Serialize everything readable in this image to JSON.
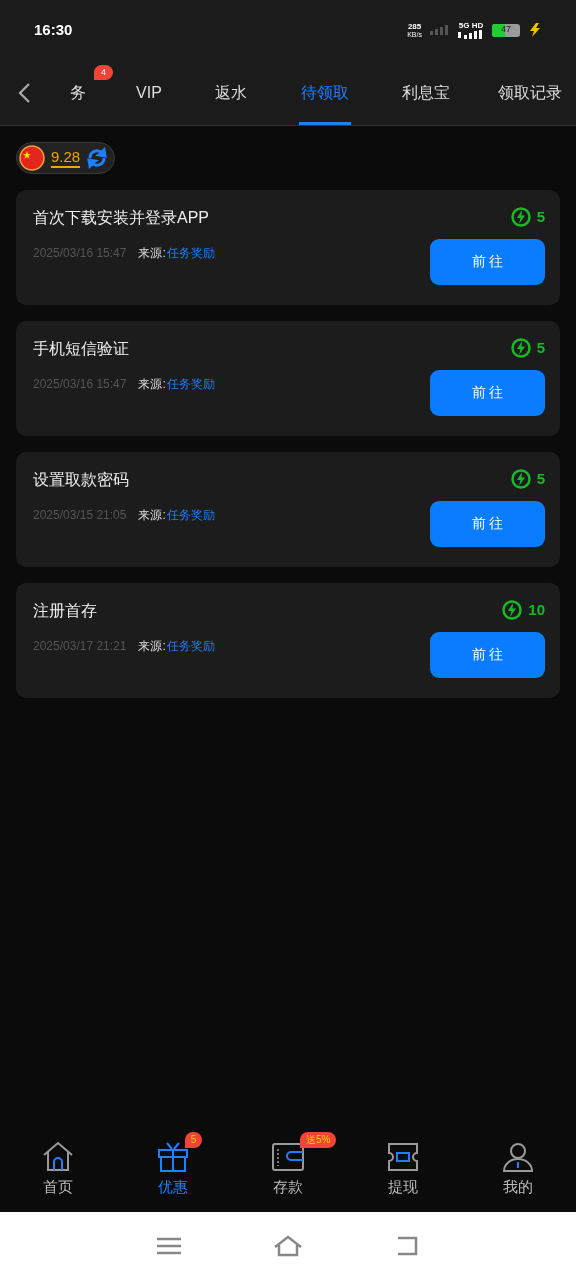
{
  "status_bar": {
    "time": "16:30",
    "speed": "285",
    "speed_unit": "KB/s",
    "network": "5G HD",
    "battery": "47"
  },
  "tabs": [
    {
      "label": "务",
      "selected": false,
      "badge": "4"
    },
    {
      "label": "VIP",
      "selected": false
    },
    {
      "label": "返水",
      "selected": false
    },
    {
      "label": "待领取",
      "selected": true
    },
    {
      "label": "利息宝",
      "selected": false
    },
    {
      "label": "领取记录",
      "selected": false
    }
  ],
  "balance": "9.28",
  "tasks": [
    {
      "title": "首次下载安装并登录APP",
      "reward": "5",
      "time": "2025/03/16 15:47",
      "source_label": "来源:",
      "source": "任务奖励",
      "button": "前 往"
    },
    {
      "title": "手机短信验证",
      "reward": "5",
      "time": "2025/03/16 15:47",
      "source_label": "来源:",
      "source": "任务奖励",
      "button": "前 往"
    },
    {
      "title": "设置取款密码",
      "reward": "5",
      "time": "2025/03/15 21:05",
      "source_label": "来源:",
      "source": "任务奖励",
      "button": "前 往"
    },
    {
      "title": "注册首存",
      "reward": "10",
      "time": "2025/03/17 21:21",
      "source_label": "来源:",
      "source": "任务奖励",
      "button": "前 往"
    }
  ],
  "bottom_nav": [
    {
      "kind": "home",
      "label": "首页",
      "selected": false
    },
    {
      "kind": "gift",
      "label": "优惠",
      "selected": true,
      "badge": "5"
    },
    {
      "kind": "wallet",
      "label": "存款",
      "selected": false,
      "badge": "送5%"
    },
    {
      "kind": "ticket",
      "label": "提现",
      "selected": false
    },
    {
      "kind": "user",
      "label": "我的",
      "selected": false
    }
  ]
}
